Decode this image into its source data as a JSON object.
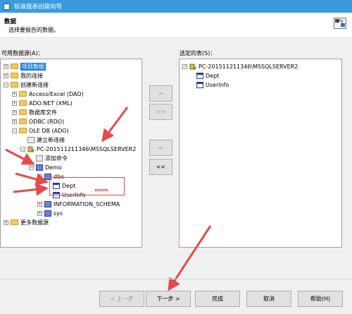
{
  "window": {
    "title": "标准报表创建向导"
  },
  "header": {
    "title": "数据",
    "subtitle": "选择要报告的数据。"
  },
  "labels": {
    "available": "可用数据源(A)：",
    "selected": "选定的表(S)："
  },
  "left_tree": {
    "items": [
      {
        "label": "项目数据",
        "expander": "+"
      },
      {
        "label": "我的连接",
        "expander": "+"
      },
      {
        "label": "创建新连接",
        "expander": "−"
      },
      {
        "label": "Access/Excel (DAO)",
        "expander": "+"
      },
      {
        "label": "ADO.NET (XML)",
        "expander": "+"
      },
      {
        "label": "数据库文件",
        "expander": "+"
      },
      {
        "label": "ODBC (RDO)",
        "expander": "+"
      },
      {
        "label": "OLE DB (ADO)",
        "expander": "−"
      },
      {
        "label": "建立新连接",
        "expander": ""
      },
      {
        "label": "PC-201511211346\\MSSQLSERVER2",
        "expander": "−"
      },
      {
        "label": "添加命令",
        "expander": ""
      },
      {
        "label": "Demo",
        "expander": "−"
      },
      {
        "label": "dbo",
        "expander": "−"
      },
      {
        "label": "Dept",
        "expander": ""
      },
      {
        "label": "UserInfo",
        "expander": ""
      },
      {
        "label": "INFORMATION_SCHEMA",
        "expander": "+"
      },
      {
        "label": "sys",
        "expander": "+"
      },
      {
        "label": "更多数据源",
        "expander": "+"
      }
    ]
  },
  "right_tree": {
    "items": [
      {
        "label": "PC-201511211346\\MSSQLSERVER2",
        "expander": "−"
      },
      {
        "label": "Dept",
        "expander": ""
      },
      {
        "label": "UserInfo",
        "expander": ""
      }
    ]
  },
  "transfer_buttons": {
    "add": ">",
    "add_all": ">>",
    "remove": "<",
    "remove_all": "<<"
  },
  "footer": {
    "back": "< 上一步",
    "next": "下一步 >",
    "finish": "完成",
    "cancel": "取消",
    "help": "帮助(H)"
  }
}
